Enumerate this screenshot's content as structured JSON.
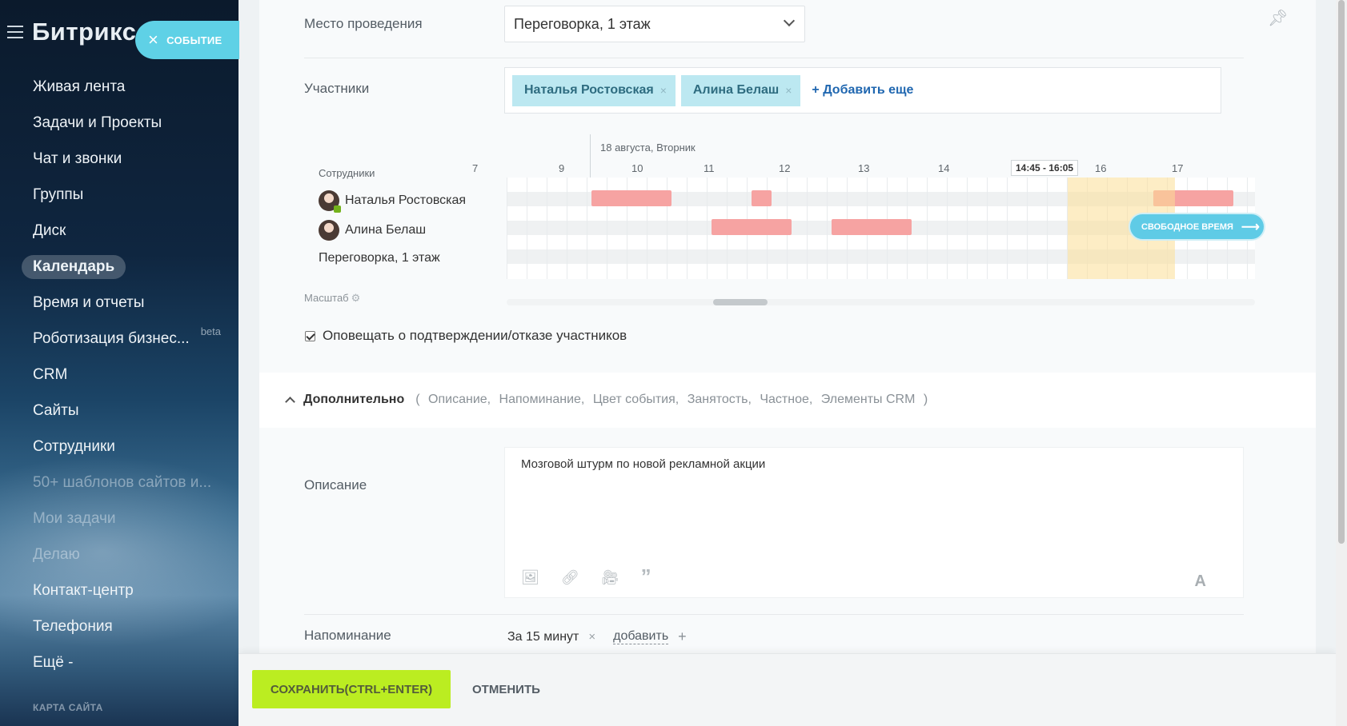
{
  "sidebar": {
    "logo": "Битрикс",
    "event_button": {
      "icon": "×",
      "label": "СОБЫТИЕ"
    },
    "items": [
      {
        "label": "Живая лента",
        "active": false,
        "dim": false
      },
      {
        "label": "Задачи и Проекты",
        "active": false,
        "dim": false
      },
      {
        "label": "Чат и звонки",
        "active": false,
        "dim": false
      },
      {
        "label": "Группы",
        "active": false,
        "dim": false
      },
      {
        "label": "Диск",
        "active": false,
        "dim": false
      },
      {
        "label": "Календарь",
        "active": true,
        "dim": false
      },
      {
        "label": "Время и отчеты",
        "active": false,
        "dim": false
      },
      {
        "label": "Роботизация бизнес...",
        "badge": "beta",
        "active": false,
        "dim": false
      },
      {
        "label": "CRM",
        "active": false,
        "dim": false
      },
      {
        "label": "Сайты",
        "active": false,
        "dim": false
      },
      {
        "label": "Сотрудники",
        "active": false,
        "dim": false
      },
      {
        "label": "50+ шаблонов сайтов и...",
        "active": false,
        "dim": true
      },
      {
        "label": "Мои задачи",
        "active": false,
        "dim": true
      },
      {
        "label": "Делаю",
        "active": false,
        "dim": true
      },
      {
        "label": "Контакт-центр",
        "active": false,
        "dim": false
      },
      {
        "label": "Телефония",
        "active": false,
        "dim": false
      },
      {
        "label": "Ещё -",
        "active": false,
        "dim": false
      }
    ],
    "sitemap": "КАРТА САЙТА"
  },
  "form": {
    "location_label": "Место проведения",
    "location_value": "Переговорка, 1 этаж",
    "participants_label": "Участники",
    "participants": [
      "Наталья Ростовская",
      "Алина Белаш"
    ],
    "remove_icon": "×",
    "add_more": "+ Добавить еще",
    "planner": {
      "date": "18 августа, Вторник",
      "employees_header": "Сотрудники",
      "hours": [
        "7",
        "9",
        "10",
        "11",
        "12",
        "13",
        "14",
        "16",
        "17"
      ],
      "selected_range": "14:45 - 16:05",
      "rows": [
        {
          "name": "Наталья Ростовская",
          "avatar": true,
          "online": true
        },
        {
          "name": "Алина Белаш",
          "avatar": true,
          "online": false
        },
        {
          "name": "Переговорка, 1 этаж",
          "avatar": false,
          "online": false
        }
      ],
      "free_time_button": "СВОБОДНОЕ ВРЕМЯ",
      "scale_label": "Масштаб"
    },
    "notify_label": "Оповещать о подтверждении/отказе участников",
    "notify_checked": true,
    "additional": {
      "title": "Дополнительно",
      "open": "(",
      "links": [
        "Описание,",
        "Напоминание,",
        "Цвет события,",
        "Занятость,",
        "Частное,",
        "Элементы CRM"
      ],
      "close": ")"
    },
    "description_label": "Описание",
    "description_value": "Мозговой штурм по новой рекламной акции",
    "editor_tools": [
      "image-icon",
      "link-icon",
      "video-icon",
      "quote-icon"
    ],
    "editor_font_button": "A",
    "reminder_label": "Напоминание",
    "reminder_value": "За 15 минут",
    "reminder_add": "добавить",
    "reminder_plus": "+"
  },
  "footer": {
    "save": "СОХРАНИТЬ(CTRL+ENTER)",
    "cancel": "ОТМЕНИТЬ"
  },
  "colors": {
    "accent": "#5fd1e6",
    "save_green": "#bbed21",
    "busy": "#f6a3a2",
    "selection": "#fcde96",
    "tag_bg": "#bce8f1"
  }
}
